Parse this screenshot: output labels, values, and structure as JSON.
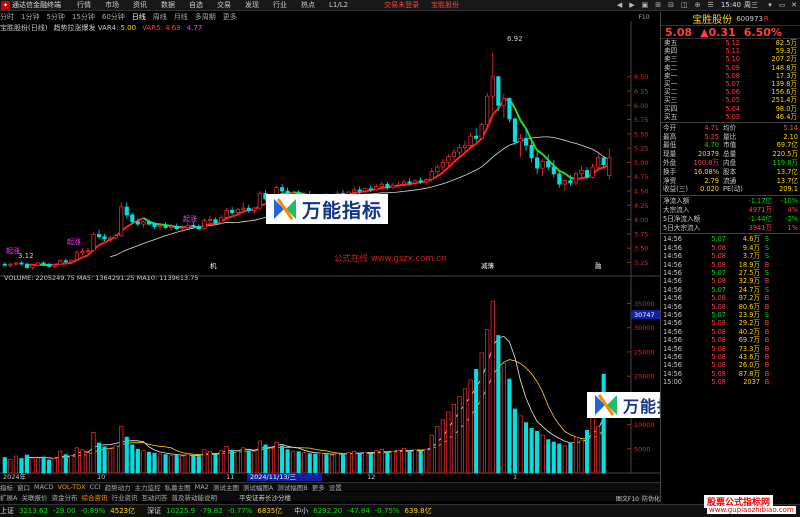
{
  "titlebar": {
    "app": "通达信金融终端",
    "menus": [
      "行情",
      "市场",
      "资讯",
      "数据",
      "自选",
      "交易",
      "发现",
      "行业",
      "热点",
      "L1/L2"
    ],
    "login": "交易未登录",
    "stock": "宝胜股份",
    "clock": "15:40",
    "weekday": "周三",
    "icons": [
      "◀",
      "▶",
      "▣",
      "⊞",
      "⊟",
      "◫",
      "⊕",
      "☰"
    ],
    "wc": [
      "▾",
      "▭",
      "✕"
    ]
  },
  "period": {
    "tabs": [
      "分时",
      "1分钟",
      "5分钟",
      "15分钟",
      "60分钟",
      "日线",
      "周线",
      "月线",
      "多周期",
      "更多"
    ],
    "active": 5
  },
  "ctl": "F10",
  "ibar": {
    "name": "宝胜股份(日线)",
    "indicator": "趋势拉涨爆发 VAR4:",
    "var4": "5.00",
    "var5": "VAR5: 4.69",
    "var6": "4.77"
  },
  "price_axis": [
    "6.50",
    "6.25",
    "6.00",
    "5.75",
    "5.50",
    "5.25",
    "5.00",
    "4.75",
    "4.50",
    "4.25",
    "4.00",
    "3.75",
    "3.50",
    "3.25"
  ],
  "vol_axis": [
    "35000",
    "30000",
    "25000",
    "20000",
    "15000",
    "10000",
    "5000"
  ],
  "hi_label": "6.92",
  "lo_label": "3.12",
  "last_label": "30747",
  "signals": [
    "起涨",
    "起涨",
    "起涨"
  ],
  "vol_title": "VOLUME: 2205249.75 MA5: 1364291.25 MA10: 1139613.75",
  "events": [
    "机",
    "减薄",
    "融"
  ],
  "date_axis": {
    "year": "2024年",
    "ticks": [
      "10",
      "11",
      "12"
    ],
    "cursor": "2024/11/13/三",
    "m1": "1"
  },
  "watermark": "万能指标",
  "site": "公式在线 www.gszx.com.cn",
  "sidebar": {
    "name": "宝胜股份",
    "code": "600973",
    "sup": "R",
    "price": "5.08",
    "chg": "▲0.31",
    "pct": "6.50%",
    "asks": [
      [
        "卖五",
        "5.12",
        "82.5万"
      ],
      [
        "卖四",
        "5.11",
        "59.3万"
      ],
      [
        "卖三",
        "5.10",
        "207.2万"
      ],
      [
        "卖二",
        "5.09",
        "148.8万"
      ],
      [
        "卖一",
        "5.08",
        "17.3万"
      ]
    ],
    "bids": [
      [
        "买一",
        "5.07",
        "139.8万"
      ],
      [
        "买二",
        "5.06",
        "156.6万"
      ],
      [
        "买三",
        "5.05",
        "251.4万"
      ],
      [
        "买四",
        "5.04",
        "98.0万"
      ],
      [
        "买五",
        "5.03",
        "46.4万"
      ]
    ],
    "quote": [
      [
        "今开",
        "4.71",
        "均价",
        "5.14"
      ],
      [
        "最高",
        "5.25",
        "量比",
        "2.10"
      ],
      [
        "最低",
        "4.70",
        "市值",
        "69.7亿"
      ],
      [
        "现量",
        "20379",
        "总量",
        "220.5万"
      ],
      [
        "外盘",
        "100.8万",
        "内盘",
        "119.8万"
      ],
      [
        "换手",
        "16.08%",
        "股本",
        "13.7亿"
      ],
      [
        "净资",
        "2.79",
        "流通",
        "13.7亿"
      ],
      [
        "收益(三)",
        "0.020",
        "PE(动)",
        "209.1"
      ]
    ],
    "flows": [
      [
        "净流入额",
        "-1.17亿",
        "-10%"
      ],
      [
        "大宗流入",
        "4971万",
        "4%"
      ],
      [
        "5日净流入额",
        "-1.44亿",
        "-2%"
      ],
      [
        "5日大宗流入",
        "3941万",
        "1%"
      ]
    ],
    "ticks": [
      [
        "14:56",
        "5.07",
        "4.6万",
        "S"
      ],
      [
        "14:56",
        "5.08",
        "9.4万",
        "S"
      ],
      [
        "14:56",
        "5.08",
        "3.7万",
        "S"
      ],
      [
        "14:56",
        "5.08",
        "18.9万",
        "B"
      ],
      [
        "14:56",
        "5.07",
        "27.5万",
        "S"
      ],
      [
        "14:56",
        "5.08",
        "32.9万",
        "B"
      ],
      [
        "14:56",
        "5.07",
        "24.7万",
        "S"
      ],
      [
        "14:56",
        "5.08",
        "97.2万",
        "B"
      ],
      [
        "14:56",
        "5.08",
        "80.6万",
        "B"
      ],
      [
        "14:56",
        "5.07",
        "23.9万",
        "S"
      ],
      [
        "14:56",
        "5.08",
        "29.2万",
        "B"
      ],
      [
        "14:56",
        "5.08",
        "40.2万",
        "B"
      ],
      [
        "14:56",
        "5.08",
        "69.7万",
        "B"
      ],
      [
        "14:56",
        "5.08",
        "73.3万",
        "B"
      ],
      [
        "14:56",
        "5.08",
        "43.6万",
        "B"
      ],
      [
        "14:56",
        "5.08",
        "26.0万",
        "B"
      ],
      [
        "14:56",
        "5.08",
        "87.8万",
        "B"
      ],
      [
        "15:00",
        "5.08",
        "2037",
        "B"
      ]
    ]
  },
  "tabs": [
    "指标",
    "窗口",
    "MACD",
    "VOL-TDX",
    "CCI",
    "趋势动力",
    "主力监控",
    "私募主图",
    "MA2",
    "测试主图",
    "测试幅图A",
    "测试幅图B",
    "更多",
    "设置"
  ],
  "tabs_active": 3,
  "tabs2": [
    "扩展A",
    "关联报价",
    "资金分布",
    "综合资讯",
    "行业资讯",
    "互动问答",
    "普及新动能说明"
  ],
  "tabs2_active": 3,
  "tab_right": [
    "图文F10",
    "防伪化",
    "操作"
  ],
  "status": [
    [
      "上证",
      "3213.62",
      "-29.00",
      "-0.89%",
      "4523亿"
    ],
    [
      "深证",
      "10225.9",
      "-79.82",
      "-0.77%",
      "6835亿"
    ],
    [
      "中小",
      "6292.20",
      "-47.84",
      "-0.75%",
      "639.8亿"
    ]
  ],
  "broker": "平安证券长沙分楼",
  "wm2": "股票公式指标网",
  "wm3": "www.gupiaozhibiao.com",
  "chart_data": {
    "type": "candlestick",
    "price_range": [
      3.1,
      6.95
    ],
    "candles": [
      [
        3.22,
        3.25,
        3.18,
        3.2
      ],
      [
        3.2,
        3.24,
        3.16,
        3.22
      ],
      [
        3.22,
        3.26,
        3.19,
        3.24
      ],
      [
        3.24,
        3.28,
        3.2,
        3.22
      ],
      [
        3.22,
        3.25,
        3.14,
        3.16
      ],
      [
        3.16,
        3.22,
        3.12,
        3.2
      ],
      [
        3.2,
        3.26,
        3.18,
        3.24
      ],
      [
        3.24,
        3.27,
        3.2,
        3.22
      ],
      [
        3.22,
        3.24,
        3.16,
        3.18
      ],
      [
        3.18,
        3.23,
        3.15,
        3.21
      ],
      [
        3.21,
        3.3,
        3.2,
        3.28
      ],
      [
        3.28,
        3.32,
        3.24,
        3.26
      ],
      [
        3.26,
        3.3,
        3.22,
        3.29
      ],
      [
        3.3,
        3.46,
        3.28,
        3.42
      ],
      [
        3.42,
        3.5,
        3.38,
        3.44
      ],
      [
        3.44,
        3.5,
        3.4,
        3.46
      ],
      [
        3.46,
        3.78,
        3.45,
        3.74
      ],
      [
        3.74,
        3.82,
        3.66,
        3.7
      ],
      [
        3.7,
        3.75,
        3.62,
        3.66
      ],
      [
        3.66,
        3.72,
        3.6,
        3.68
      ],
      [
        3.68,
        3.76,
        3.66,
        3.72
      ],
      [
        3.72,
        4.3,
        3.7,
        4.22
      ],
      [
        4.22,
        4.3,
        4.02,
        4.08
      ],
      [
        4.08,
        4.12,
        3.92,
        3.96
      ],
      [
        3.96,
        4.02,
        3.88,
        3.92
      ],
      [
        3.92,
        3.98,
        3.86,
        3.96
      ],
      [
        3.96,
        4.0,
        3.9,
        3.92
      ],
      [
        3.92,
        3.96,
        3.84,
        3.88
      ],
      [
        3.88,
        3.94,
        3.82,
        3.9
      ],
      [
        3.9,
        3.95,
        3.84,
        3.86
      ],
      [
        3.86,
        3.92,
        3.8,
        3.88
      ],
      [
        3.88,
        3.93,
        3.82,
        3.84
      ],
      [
        3.84,
        3.9,
        3.78,
        3.86
      ],
      [
        3.86,
        3.94,
        3.84,
        3.9
      ],
      [
        3.9,
        3.96,
        3.86,
        3.88
      ],
      [
        3.88,
        3.92,
        3.82,
        3.84
      ],
      [
        3.84,
        4.02,
        3.82,
        3.98
      ],
      [
        3.98,
        4.06,
        3.94,
        4.0
      ],
      [
        4.0,
        4.04,
        3.92,
        3.94
      ],
      [
        3.94,
        4.08,
        3.92,
        4.04
      ],
      [
        4.04,
        4.2,
        4.0,
        4.16
      ],
      [
        4.16,
        4.22,
        4.08,
        4.12
      ],
      [
        4.12,
        4.2,
        4.1,
        4.18
      ],
      [
        4.18,
        4.3,
        4.14,
        4.2
      ],
      [
        4.2,
        4.26,
        4.12,
        4.16
      ],
      [
        4.16,
        4.22,
        4.1,
        4.2
      ],
      [
        4.2,
        4.5,
        4.18,
        4.46
      ],
      [
        4.46,
        4.52,
        4.32,
        4.36
      ],
      [
        4.36,
        4.42,
        4.28,
        4.4
      ],
      [
        4.4,
        4.6,
        4.38,
        4.56
      ],
      [
        4.56,
        4.62,
        4.46,
        4.5
      ],
      [
        4.5,
        4.56,
        4.42,
        4.44
      ],
      [
        4.44,
        4.5,
        4.36,
        4.46
      ],
      [
        4.46,
        4.52,
        4.38,
        4.4
      ],
      [
        4.4,
        4.48,
        4.34,
        4.42
      ],
      [
        4.42,
        4.5,
        4.36,
        4.38
      ],
      [
        4.38,
        4.44,
        4.3,
        4.36
      ],
      [
        4.36,
        4.42,
        4.28,
        4.4
      ],
      [
        4.4,
        4.46,
        4.34,
        4.38
      ],
      [
        4.38,
        4.44,
        4.32,
        4.42
      ],
      [
        4.42,
        4.5,
        4.38,
        4.46
      ],
      [
        4.46,
        4.52,
        4.4,
        4.44
      ],
      [
        4.44,
        4.5,
        4.38,
        4.48
      ],
      [
        4.48,
        4.58,
        4.46,
        4.52
      ],
      [
        4.52,
        4.58,
        4.44,
        4.5
      ],
      [
        4.5,
        4.56,
        4.46,
        4.54
      ],
      [
        4.54,
        4.6,
        4.48,
        4.52
      ],
      [
        4.52,
        4.62,
        4.5,
        4.58
      ],
      [
        4.58,
        4.66,
        4.54,
        4.62
      ],
      [
        4.62,
        4.66,
        4.52,
        4.56
      ],
      [
        4.56,
        4.64,
        4.54,
        4.6
      ],
      [
        4.6,
        4.66,
        4.56,
        4.62
      ],
      [
        4.62,
        4.7,
        4.58,
        4.66
      ],
      [
        4.66,
        4.72,
        4.6,
        4.64
      ],
      [
        4.64,
        4.7,
        4.6,
        4.68
      ],
      [
        4.68,
        4.74,
        4.62,
        4.66
      ],
      [
        4.66,
        4.72,
        4.6,
        4.7
      ],
      [
        4.7,
        4.9,
        4.66,
        4.84
      ],
      [
        4.84,
        4.96,
        4.8,
        4.92
      ],
      [
        4.92,
        5.06,
        4.86,
        5.0
      ],
      [
        5.0,
        5.14,
        4.94,
        5.1
      ],
      [
        5.1,
        5.24,
        5.04,
        5.18
      ],
      [
        5.18,
        5.32,
        5.12,
        5.26
      ],
      [
        5.26,
        5.38,
        5.18,
        5.3
      ],
      [
        5.3,
        5.52,
        5.26,
        5.46
      ],
      [
        5.46,
        5.6,
        5.36,
        5.42
      ],
      [
        5.42,
        5.7,
        5.4,
        5.66
      ],
      [
        5.66,
        6.22,
        5.62,
        6.16
      ],
      [
        6.16,
        6.92,
        5.9,
        6.5
      ],
      [
        6.5,
        6.52,
        5.9,
        6.0
      ],
      [
        6.0,
        6.2,
        5.78,
        6.12
      ],
      [
        6.12,
        6.14,
        5.7,
        5.76
      ],
      [
        5.76,
        5.8,
        5.3,
        5.36
      ],
      [
        5.36,
        5.5,
        5.1,
        5.42
      ],
      [
        5.42,
        5.6,
        5.2,
        5.3
      ],
      [
        5.3,
        5.44,
        5.0,
        5.08
      ],
      [
        5.08,
        5.2,
        4.8,
        4.9
      ],
      [
        4.9,
        5.06,
        4.76,
        5.02
      ],
      [
        5.02,
        5.14,
        4.86,
        4.92
      ],
      [
        4.92,
        5.04,
        4.74,
        4.8
      ],
      [
        4.8,
        4.86,
        4.56,
        4.62
      ],
      [
        4.62,
        4.72,
        4.5,
        4.68
      ],
      [
        4.68,
        4.78,
        4.58,
        4.64
      ],
      [
        4.64,
        4.84,
        4.6,
        4.8
      ],
      [
        4.8,
        4.94,
        4.72,
        4.86
      ],
      [
        4.86,
        4.92,
        4.7,
        4.74
      ],
      [
        4.74,
        4.98,
        4.72,
        4.92
      ],
      [
        4.92,
        5.16,
        4.88,
        5.08
      ],
      [
        5.08,
        5.12,
        4.9,
        4.96
      ],
      [
        4.77,
        5.25,
        4.7,
        5.08
      ]
    ],
    "volumes": [
      3200,
      2800,
      3500,
      3000,
      3700,
      2900,
      3100,
      3300,
      2700,
      3000,
      4500,
      3800,
      3600,
      5200,
      4800,
      4200,
      8400,
      6200,
      5400,
      5000,
      5600,
      9600,
      7400,
      5800,
      4900,
      4600,
      4300,
      4100,
      3900,
      3800,
      3600,
      3700,
      3500,
      3900,
      3600,
      3400,
      4800,
      4400,
      3800,
      4600,
      5500,
      4700,
      4500,
      5200,
      4600,
      4400,
      6600,
      5800,
      5100,
      6400,
      5600,
      4800,
      4500,
      4400,
      4200,
      4000,
      3900,
      4100,
      3800,
      3700,
      4000,
      3900,
      4200,
      4500,
      4100,
      4300,
      4000,
      4600,
      4900,
      4300,
      4500,
      4700,
      5100,
      4600,
      4800,
      4500,
      4900,
      7800,
      9600,
      11000,
      12600,
      14200,
      15800,
      17400,
      19200,
      21400,
      24800,
      29600,
      35500,
      28400,
      22600,
      19400,
      13200,
      11800,
      10400,
      9200,
      8600,
      7800,
      6900,
      6400,
      6000,
      5600,
      6200,
      7400,
      6800,
      8800,
      12200,
      9600,
      20400
    ]
  }
}
